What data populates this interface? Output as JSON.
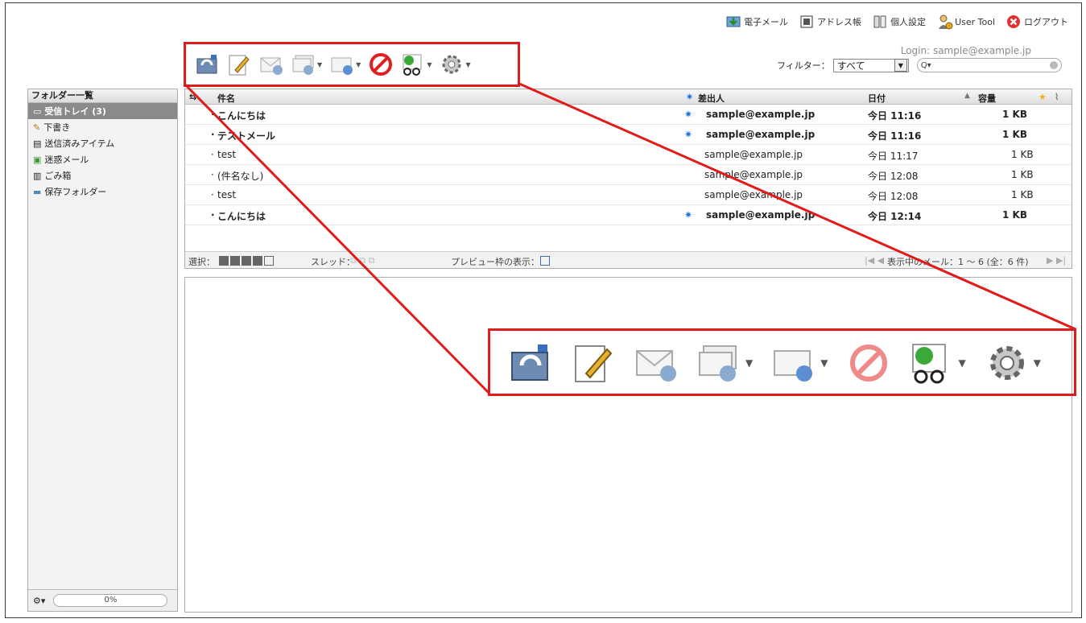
{
  "top_menu": [
    {
      "label": "電子メール",
      "icon": "email-icon"
    },
    {
      "label": "アドレス帳",
      "icon": "address-book-icon"
    },
    {
      "label": "個人設定",
      "icon": "personal-settings-icon"
    },
    {
      "label": "User Tool",
      "icon": "user-tool-icon"
    },
    {
      "label": "ログアウト",
      "icon": "logout-icon"
    }
  ],
  "login_text": "Login: sample@example.jp",
  "filter": {
    "label": "フィルター：",
    "selected": "すべて"
  },
  "search": {
    "placeholder": ""
  },
  "folders": {
    "header": "フォルダー一覧",
    "items": [
      {
        "label": "受信トレイ (3)",
        "icon": "inbox-icon",
        "selected": true
      },
      {
        "label": "下書き",
        "icon": "pencil-icon",
        "selected": false
      },
      {
        "label": "送信済みアイテム",
        "icon": "sent-icon",
        "selected": false
      },
      {
        "label": "迷惑メール",
        "icon": "spam-icon",
        "selected": false
      },
      {
        "label": "ごみ箱",
        "icon": "trash-icon",
        "selected": false
      },
      {
        "label": "保存フォルダー",
        "icon": "folder-icon",
        "selected": false
      }
    ],
    "quota": "0%"
  },
  "columns": {
    "subject": "件名",
    "from": "差出人",
    "date": "日付",
    "size": "容量"
  },
  "messages": [
    {
      "subject": "こんにちは",
      "from": "sample@example.jp",
      "date": "今日 11:16",
      "size": "1 KB",
      "unread": true
    },
    {
      "subject": "テストメール",
      "from": "sample@example.jp",
      "date": "今日 11:16",
      "size": "1 KB",
      "unread": true
    },
    {
      "subject": "test",
      "from": "sample@example.jp",
      "date": "今日 11:17",
      "size": "1 KB",
      "unread": false
    },
    {
      "subject": "(件名なし)",
      "from": "sample@example.jp",
      "date": "今日 12:08",
      "size": "1 KB",
      "unread": false
    },
    {
      "subject": "test",
      "from": "sample@example.jp",
      "date": "今日 12:08",
      "size": "1 KB",
      "unread": false
    },
    {
      "subject": "こんにちは",
      "from": "sample@example.jp",
      "date": "今日 12:14",
      "size": "1 KB",
      "unread": true
    }
  ],
  "list_footer": {
    "select_label": "選択：",
    "thread_label": "スレッド：",
    "preview_label": "プレビュー枠の表示：",
    "pagination": "表示中のメール：1 ～ 6 (全：6 件)"
  },
  "toolbar": [
    {
      "name": "check-mail",
      "icon": "refresh-mail-icon",
      "has_menu": false,
      "enabled": true
    },
    {
      "name": "compose",
      "icon": "compose-pencil-icon",
      "has_menu": false,
      "enabled": true
    },
    {
      "name": "reply",
      "icon": "reply-icon",
      "has_menu": false,
      "enabled": false
    },
    {
      "name": "reply-all",
      "icon": "reply-all-icon",
      "has_menu": true,
      "enabled": false
    },
    {
      "name": "forward",
      "icon": "forward-icon",
      "has_menu": true,
      "enabled": false
    },
    {
      "name": "delete",
      "icon": "delete-icon",
      "has_menu": false,
      "enabled": true
    },
    {
      "name": "mark",
      "icon": "mark-read-icon",
      "has_menu": true,
      "enabled": true
    },
    {
      "name": "more",
      "icon": "gear-icon",
      "has_menu": true,
      "enabled": true
    }
  ],
  "colors": {
    "highlight": "#e01b1b",
    "unread_star": "#1e6fe0",
    "selected_folder": "#8a8a8a"
  }
}
